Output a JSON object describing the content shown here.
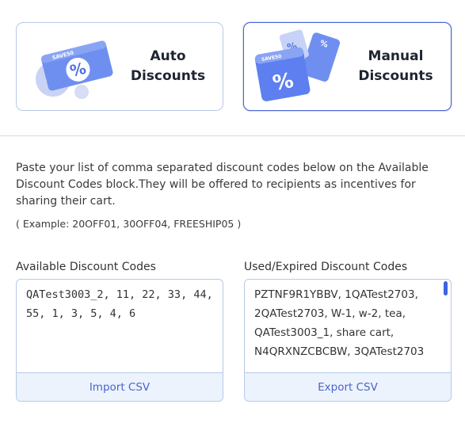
{
  "tabs": [
    {
      "title_line1": "Auto",
      "title_line2": "Discounts",
      "icon": "percent-gear-icon",
      "selected": false
    },
    {
      "title_line1": "Manual",
      "title_line2": "Discounts",
      "icon": "coupon-tickets-icon",
      "selected": true
    }
  ],
  "description": "Paste your list of comma separated discount codes below on the Available Discount Codes block.They will be offered to recipients as incentives for sharing their cart.",
  "example": "( Example: 20OFF01, 30OFF04, FREESHIP05 )",
  "available": {
    "label": "Available Discount Codes",
    "value": "QATest3003_2, 11, 22, 33, 44, 55, 1, 3, 5, 4, 6",
    "action_label": "Import CSV"
  },
  "used": {
    "label": "Used/Expired Discount Codes",
    "value": "PZTNF9R1YBBV, 1QATest2703, 2QATest2703, W-1, w-2, tea, QATest3003_1, share cart, N4QRXNZCBCBW, 3QATest2703",
    "action_label": "Export CSV"
  },
  "art_text": {
    "coupon_label": "SAVE50"
  },
  "colors": {
    "accent": "#4a67d6",
    "border": "#b7c9e6",
    "button_bg": "#ecf3fd",
    "button_text": "#4a64c8"
  }
}
